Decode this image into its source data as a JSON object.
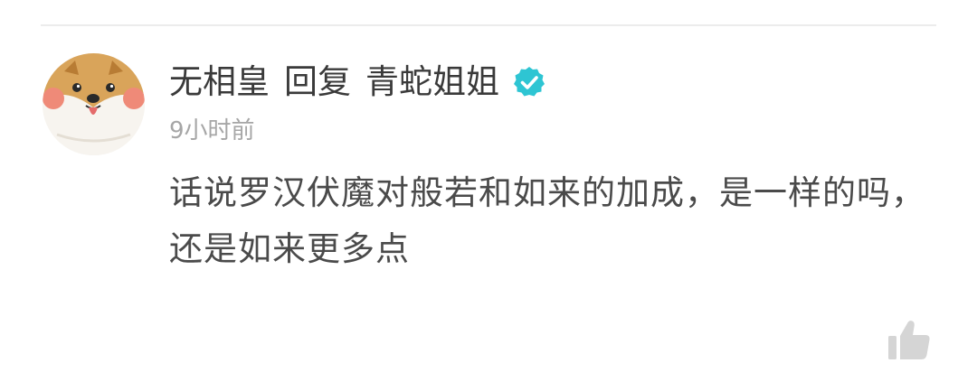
{
  "comment": {
    "author": "无相皇",
    "reply_word": "回复",
    "reply_target": "青蛇姐姐",
    "time": "9小时前",
    "text": "话说罗汉伏魔对般若和如来的加成，是一样的吗，还是如来更多点"
  },
  "icons": {
    "verified": "verified-check-icon",
    "like": "thumbs-up-icon"
  },
  "colors": {
    "verified": "#2ec5d3",
    "text": "#4a4a4a",
    "muted": "#a6a6a6",
    "like": "#d5d5d5"
  }
}
